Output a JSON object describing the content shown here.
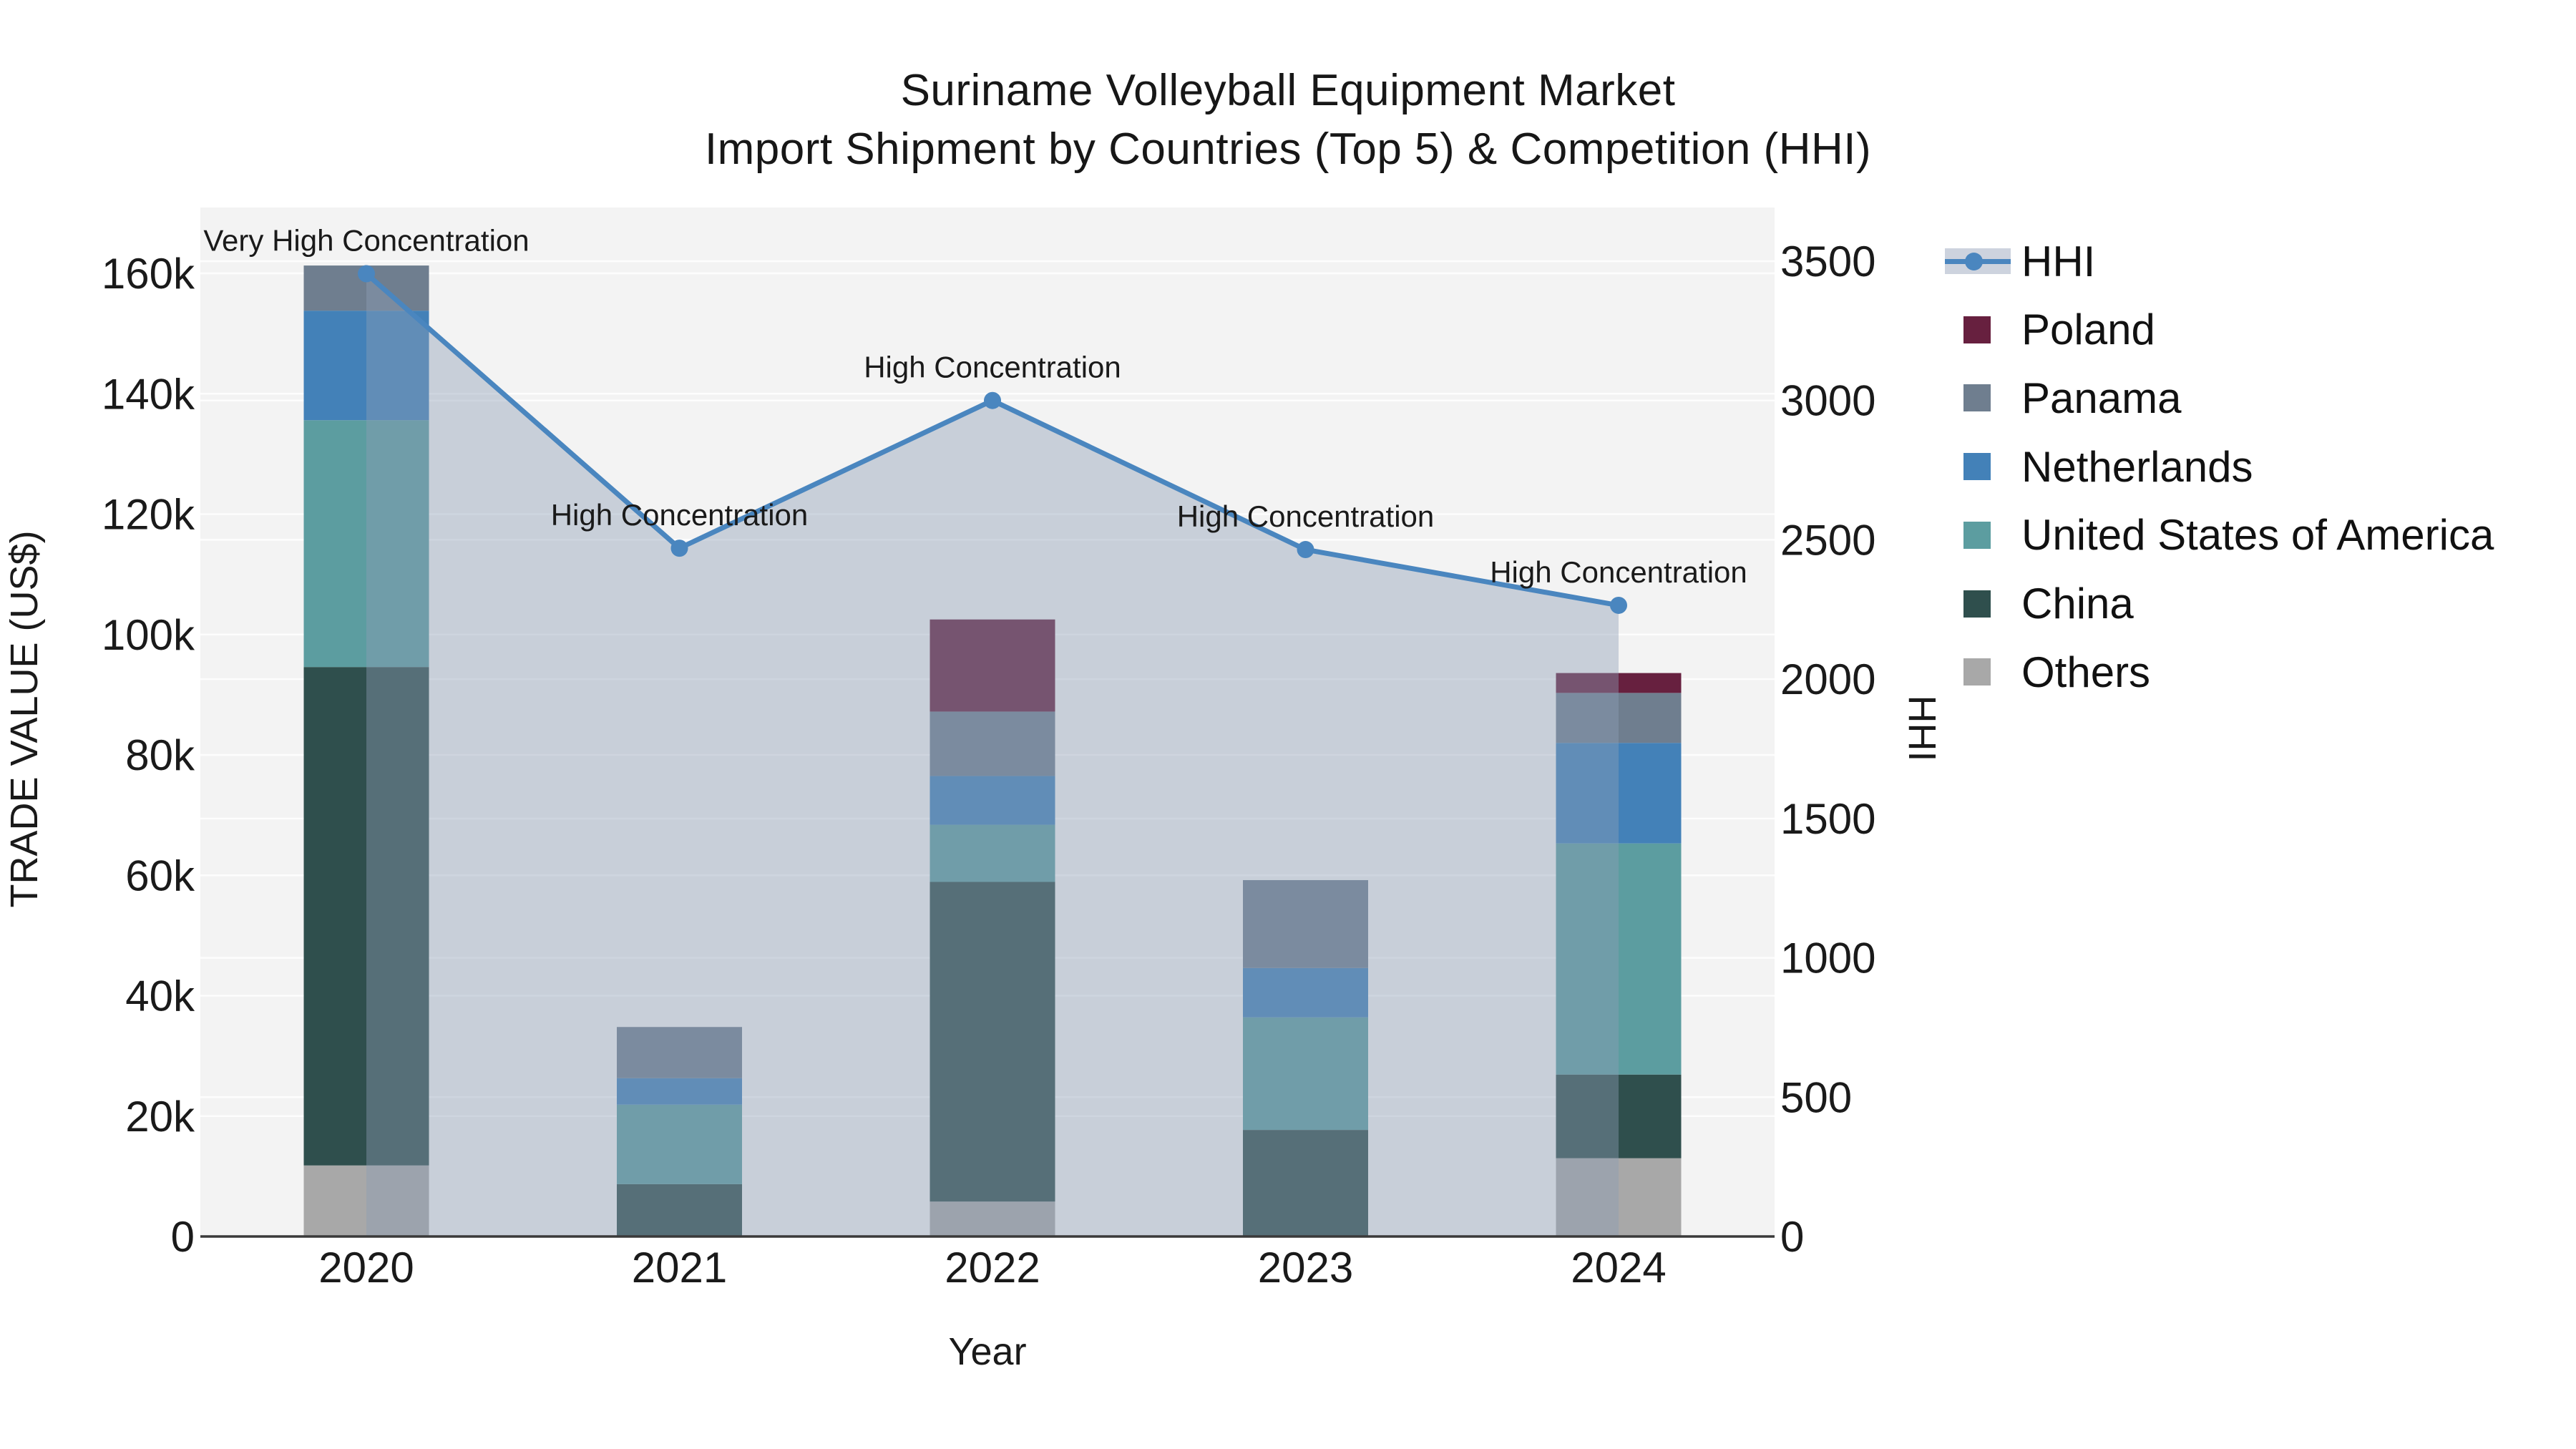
{
  "title": {
    "line1": "Suriname Volleyball Equipment Market",
    "line2": "Import Shipment by Countries (Top 5) & Competition (HHI)"
  },
  "axes": {
    "left": {
      "label": "TRADE VALUE (US$)",
      "tick_labels": [
        "0",
        "20k",
        "40k",
        "60k",
        "80k",
        "100k",
        "120k",
        "140k",
        "160k"
      ],
      "tick_values": [
        0,
        20000,
        40000,
        60000,
        80000,
        100000,
        120000,
        140000,
        160000
      ]
    },
    "right": {
      "label": "HHI",
      "tick_labels": [
        "0",
        "500",
        "1000",
        "1500",
        "2000",
        "2500",
        "3000",
        "3500"
      ],
      "tick_values": [
        0,
        500,
        1000,
        1500,
        2000,
        2500,
        3000,
        3500
      ]
    },
    "x": {
      "label": "Year",
      "tick_labels": [
        "2020",
        "2021",
        "2022",
        "2023",
        "2024"
      ]
    }
  },
  "legend": {
    "items": [
      {
        "label": "HHI",
        "kind": "line",
        "color_key": "hhi_line"
      },
      {
        "label": "Poland",
        "kind": "square",
        "color_key": "poland"
      },
      {
        "label": "Panama",
        "kind": "square",
        "color_key": "panama"
      },
      {
        "label": "Netherlands",
        "kind": "square",
        "color_key": "netherlands"
      },
      {
        "label": "United States of America",
        "kind": "square",
        "color_key": "usa"
      },
      {
        "label": "China",
        "kind": "square",
        "color_key": "china"
      },
      {
        "label": "Others",
        "kind": "square",
        "color_key": "others"
      }
    ]
  },
  "chart_data": {
    "type": "combo: stacked bar (left axis, trade value US$) + line with area fill (right axis, HHI)",
    "title": "Suriname Volleyball Equipment Market — Import Shipment by Countries (Top 5) & Competition (HHI)",
    "xlabel": "Year",
    "ylabel_left": "TRADE VALUE (US$)",
    "ylabel_right": "HHI",
    "ylim_left": [
      0,
      171000
    ],
    "ylim_right": [
      0,
      3580
    ],
    "grid": "horizontal gridlines for both axes, white on light gray plot background",
    "legend_position": "outside right",
    "categories": [
      "2020",
      "2021",
      "2022",
      "2023",
      "2024"
    ],
    "bar_series_bottom_to_top": [
      {
        "name": "Others",
        "color_key": "others",
        "values": [
          11800,
          0,
          5800,
          0,
          13000
        ]
      },
      {
        "name": "China",
        "color_key": "china",
        "values": [
          82800,
          8700,
          53100,
          17700,
          13900
        ]
      },
      {
        "name": "United States of America",
        "color_key": "usa",
        "values": [
          41000,
          13200,
          9500,
          18700,
          38400
        ]
      },
      {
        "name": "Netherlands",
        "color_key": "netherlands",
        "values": [
          18200,
          4400,
          8100,
          8200,
          16700
        ]
      },
      {
        "name": "Panama",
        "color_key": "panama",
        "values": [
          7500,
          8500,
          10700,
          14600,
          8300
        ]
      },
      {
        "name": "Poland",
        "color_key": "poland",
        "values": [
          0,
          0,
          15300,
          0,
          3300
        ]
      }
    ],
    "bar_totals": [
      161300,
      34800,
      102500,
      59200,
      93600
    ],
    "line_series": {
      "name": "HHI",
      "axis": "right",
      "values": [
        3455,
        2470,
        3000,
        2465,
        2265
      ]
    },
    "annotations": [
      "Very High Concentration",
      "High Concentration",
      "High Concentration",
      "High Concentration",
      "High Concentration"
    ]
  },
  "colors": {
    "poland": "#67203f",
    "panama": "#6f7e8f",
    "netherlands": "#4381b8",
    "usa": "#5c9da0",
    "china": "#2f4f4d",
    "others": "#a8a8a8",
    "hhi_line": "#4a86bf",
    "hhi_area_fill": "rgba(140,157,182,0.42)",
    "plot_bg": "#f3f3f3",
    "gridline": "#ffffff",
    "spine": "#3a3a3a",
    "text": "#1a1a1a"
  }
}
